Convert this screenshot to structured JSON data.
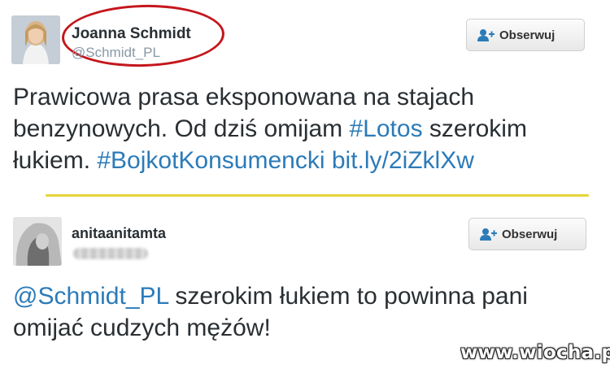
{
  "tweets": [
    {
      "user": {
        "name": "Joanna Schmidt",
        "handle": "@Schmidt_PL"
      },
      "follow_label": "Obserwuj",
      "text": [
        {
          "t": "Prawicowa prasa eksponowana na stajach benzynowych. Od dziś omijam ",
          "link": false
        },
        {
          "t": "#Lotos",
          "link": true
        },
        {
          "t": " szerokim łukiem. ",
          "link": false
        },
        {
          "t": "#BojkotKonsumencki",
          "link": true
        },
        {
          "t": " ",
          "link": false
        },
        {
          "t": "bit.ly/2iZklXw",
          "link": true
        }
      ]
    },
    {
      "user": {
        "name": "anitaanitamta",
        "handle": ""
      },
      "follow_label": "Obserwuj",
      "text": [
        {
          "t": "@Schmidt_PL",
          "link": true
        },
        {
          "t": " szerokim łukiem to powinna pani omijać cudzych mężów!",
          "link": false
        }
      ]
    }
  ],
  "watermark": "www.wiocha.pl",
  "colors": {
    "link": "#2b7bb9",
    "highlight": "#c4161c",
    "divider": "#e6d43a"
  },
  "icons": {
    "follow": "add-user-icon"
  }
}
